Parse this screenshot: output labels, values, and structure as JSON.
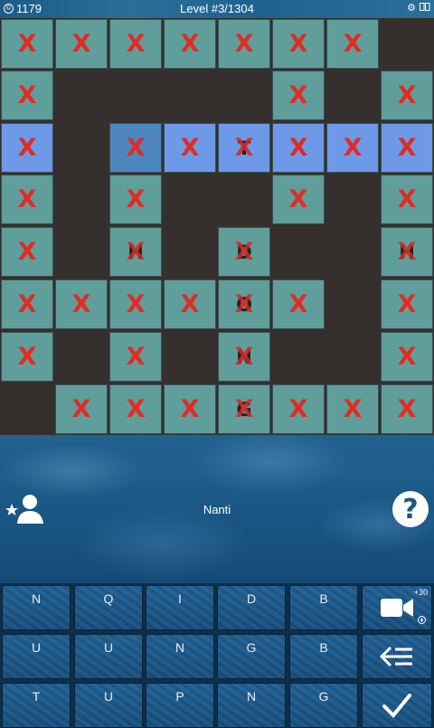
{
  "topbar": {
    "coins": "1179",
    "level": "Level #3/1304",
    "icons": [
      "settings-icon",
      "slides-icon"
    ]
  },
  "grid": {
    "rows": [
      [
        "X",
        "X",
        "X",
        "X",
        "X",
        "X",
        "X",
        null
      ],
      [
        "X",
        null,
        null,
        null,
        null,
        "X",
        null,
        "X"
      ],
      [
        "X",
        null,
        "X",
        "X",
        "TX",
        "X",
        "X",
        "X"
      ],
      [
        "X",
        null,
        "X",
        null,
        null,
        "X",
        null,
        "X"
      ],
      [
        "X",
        null,
        "HX",
        null,
        "DX",
        null,
        null,
        "HX"
      ],
      [
        "X",
        "X",
        "X",
        "X",
        "OX",
        "X",
        null,
        "X"
      ],
      [
        "X",
        null,
        "X",
        null,
        "NX",
        null,
        null,
        "X"
      ],
      [
        null,
        "X",
        "X",
        "X",
        "GX",
        "X",
        "X",
        "X"
      ]
    ],
    "highlighted_row": 2,
    "selected_cell": [
      2,
      2
    ],
    "letters": {
      "r2c4": "T",
      "r4c2": "H",
      "r4c4": "D",
      "r4c7": "H",
      "r5c4": "O",
      "r6c4": "N",
      "r7c4": "G"
    },
    "mark": "X"
  },
  "clue": "Nanti",
  "help_label": "?",
  "keyboard": {
    "rows": [
      [
        "N",
        "Q",
        "I",
        "D",
        "B"
      ],
      [
        "U",
        "U",
        "N",
        "G",
        "B"
      ],
      [
        "T",
        "U",
        "P",
        "N",
        "G"
      ]
    ],
    "video_badge": "+30",
    "actions": [
      "video-hint",
      "backspace",
      "confirm"
    ]
  }
}
